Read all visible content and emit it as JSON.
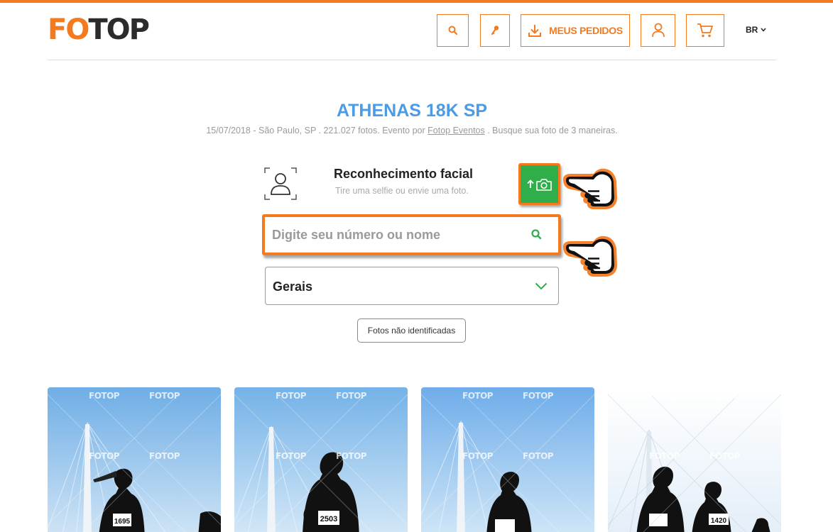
{
  "brand": {
    "logo_part1": "FO",
    "logo_part2": "TOP",
    "accent": "#f47a1f",
    "dark": "#2b2b2b"
  },
  "header": {
    "search_icon": "search-icon",
    "key_icon": "key-icon",
    "orders_label": "MEUS PEDIDOS",
    "orders_icon": "download-icon",
    "user_icon": "user-icon",
    "cart_icon": "cart-icon",
    "lang_label": "BR"
  },
  "event": {
    "title": "ATHENAS 18K SP",
    "meta_prefix": "15/07/2018 - São Paulo, SP . 221.027 fotos. Evento por ",
    "organizer": "Fotop Eventos",
    "meta_suffix": " . Busque sua foto de 3 maneiras.",
    "title_color": "#4b9be6"
  },
  "facial": {
    "title": "Reconhecimento facial",
    "subtitle": "Tire uma selfie ou envie uma foto.",
    "button_color": "#2fae4a"
  },
  "search": {
    "placeholder": "Digite seu número ou nome",
    "value": ""
  },
  "filter": {
    "selected": "Gerais"
  },
  "unidentified_label": "Fotos não identificadas",
  "photos": [
    {
      "bibs": [
        "1695"
      ]
    },
    {
      "bibs": [
        "2503"
      ]
    },
    {
      "bibs": []
    },
    {
      "bibs": [
        "1420"
      ]
    }
  ],
  "watermark": "FOTOP"
}
